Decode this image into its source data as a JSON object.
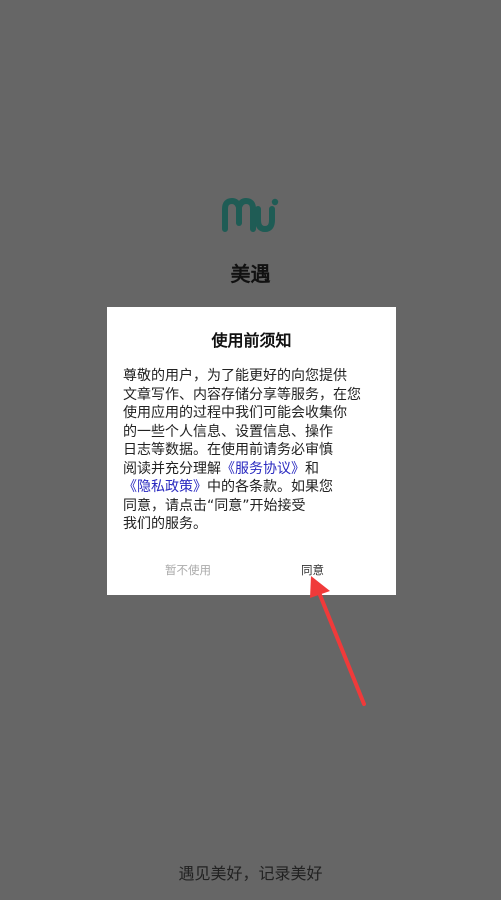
{
  "app": {
    "logo_text": "MU",
    "name": "美遇",
    "slogan": "遇见美好，记录美好"
  },
  "dialog": {
    "title": "使用前须知",
    "lines": {
      "l1": "尊敬的用户，为了能更好的向您提供",
      "l2": "文章写作、内容存储分享等服务，在您",
      "l3": "使用应用的过程中我们可能会收集你",
      "l4": "的一些个人信息、设置信息、操作",
      "l5": "日志等数据。在使用前请务必审慎",
      "l6_pre": "阅读并充分理解",
      "service_link": "《服务协议》",
      "l6_post": "和",
      "privacy_link": "《隐私政策》",
      "l7_post": "中的各条款。如果您",
      "l8": "同意，请点击“同意”开始接受",
      "l9": "我们的服务。"
    },
    "decline_label": "暂不使用",
    "agree_label": "同意"
  },
  "colors": {
    "background": "#666666",
    "logo": "#1f5c55",
    "link": "#2a2ac0",
    "arrow": "#f03a3a"
  },
  "icons": {
    "logo": "mu-logo-icon",
    "pointer": "red-arrow-icon"
  }
}
